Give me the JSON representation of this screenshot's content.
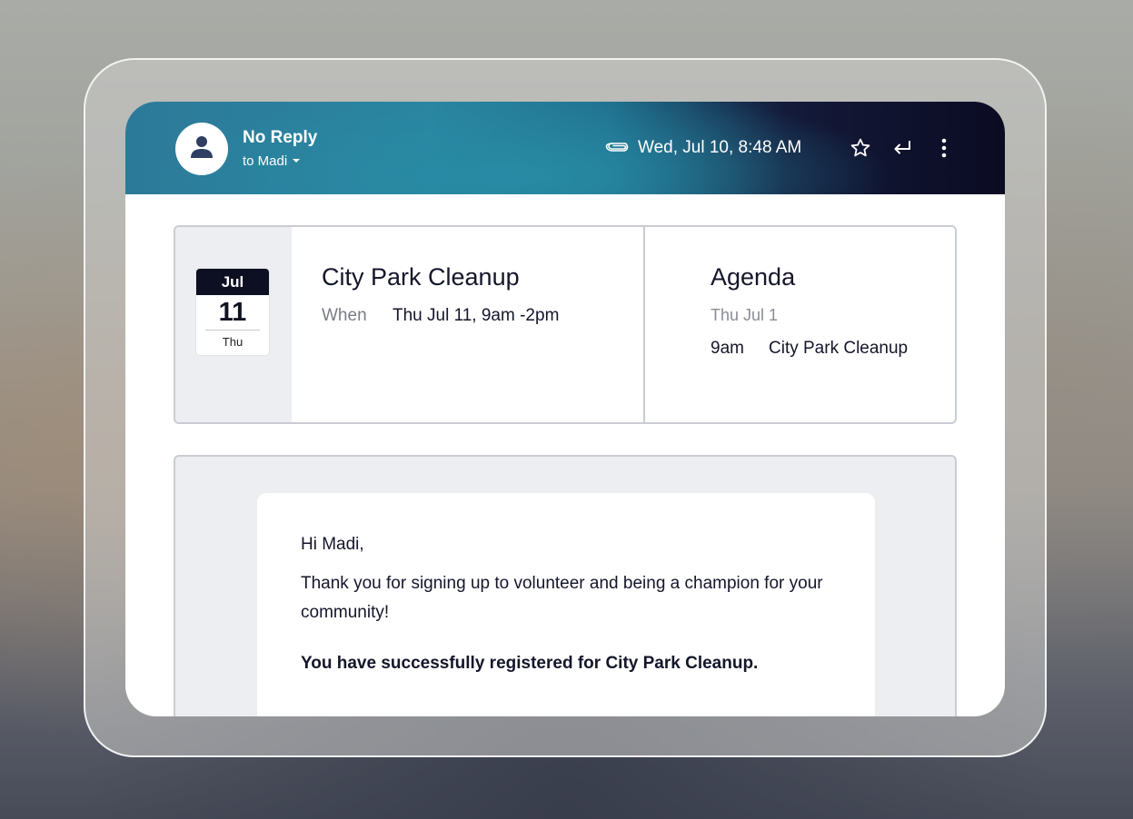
{
  "email": {
    "sender_name": "No Reply",
    "recipient_label": "to Madi",
    "timestamp": "Wed, Jul 10, 8:48 AM",
    "icons": [
      "person-icon",
      "chevron-down-icon",
      "paperclip-icon",
      "star-icon",
      "reply-icon",
      "more-vertical-icon"
    ]
  },
  "event": {
    "month": "Jul",
    "day": "11",
    "weekday": "Thu",
    "title": "City Park Cleanup",
    "when_label": "When",
    "when_value": "Thu Jul 11, 9am -2pm"
  },
  "agenda": {
    "title": "Agenda",
    "date": "Thu Jul 1",
    "items": [
      {
        "time": "9am",
        "event": "City Park Cleanup"
      }
    ]
  },
  "message": {
    "greeting": "Hi Madi,",
    "paragraph": "Thank you for signing up to volunteer and being a champion for your community!",
    "confirmation": "You have successfully registered for City Park Cleanup."
  },
  "colors": {
    "header_start": "#2a84a0",
    "header_end": "#0b0b22",
    "text_primary": "#14162a",
    "text_muted": "#7a7d87",
    "panel_gray": "#eceef2"
  }
}
